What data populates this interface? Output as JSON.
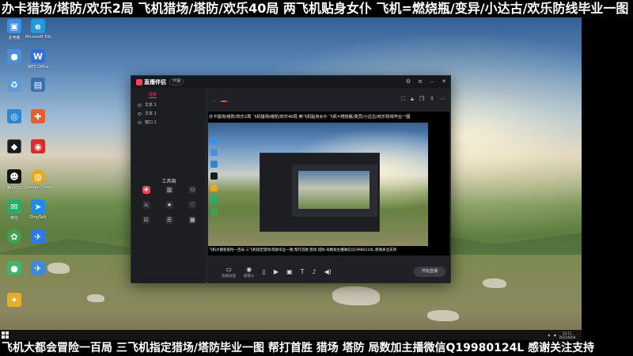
{
  "banners": {
    "top": "办卡猎场/塔防/欢乐2局 飞机猎场/塔防/欢乐40局 两飞机贴身女仆 飞机=燃烧瓶/变异/小达古/欢乐防线毕业一图",
    "bottom": "飞机大都会冒险一百局 三飞机指定猎场/塔防毕业一图 帮打首胜 猎场 塔防 局数加主播微信Q19980124L 感谢关注支持"
  },
  "desktop_icons": [
    {
      "label": "此电脑",
      "icon": "computer-icon",
      "color": "#3b8fe8"
    },
    {
      "label": "Microsoft Edge",
      "icon": "edge-icon",
      "color": "#1e9be0"
    },
    {
      "label": "",
      "icon": "person-icon",
      "color": "#4a90d9"
    },
    {
      "label": "WPS Office",
      "icon": "wps-icon",
      "color": "#2f6fd8"
    },
    {
      "label": "",
      "icon": "recycle-icon",
      "color": "#5b9bd5"
    },
    {
      "label": "",
      "icon": "app-icon",
      "color": "#3a6fb0"
    },
    {
      "label": "",
      "icon": "network-icon",
      "color": "#2b86d6"
    },
    {
      "label": "",
      "icon": "tools-icon",
      "color": "#e85d2c"
    },
    {
      "label": "",
      "icon": "game-icon",
      "color": "#1b1b1b"
    },
    {
      "label": "",
      "icon": "netease-icon",
      "color": "#d92c2c"
    },
    {
      "label": "腾讯QQ",
      "icon": "qq-icon",
      "color": "#141414"
    },
    {
      "label": "Google Chrome",
      "icon": "chrome-icon",
      "color": "#e9a91c"
    },
    {
      "label": "微信",
      "icon": "wechat-icon",
      "color": "#2aae67"
    },
    {
      "label": "DingTalk",
      "icon": "dingtalk-icon",
      "color": "#1a8cf0"
    },
    {
      "label": "",
      "icon": "app2-icon",
      "color": "#3fa34d"
    },
    {
      "label": "",
      "icon": "bird-icon",
      "color": "#2b7ae8"
    },
    {
      "label": "",
      "icon": "game2-icon",
      "color": "#3fb56a"
    },
    {
      "label": "",
      "icon": "plane-icon",
      "color": "#3c8ad8"
    },
    {
      "label": "",
      "icon": "puzzle-icon",
      "color": "#e6ad2b"
    }
  ],
  "app": {
    "name": "直播伴侣",
    "title_badge": "开播",
    "announcement": "",
    "left_tabs": [
      "",
      "",
      "场景"
    ],
    "scenes": [
      "文本 1",
      "文本 1",
      "窗口 1"
    ],
    "toolbox_title": "工具箱",
    "tools": [
      {
        "label": "",
        "icon": "gift-icon",
        "hot": true
      },
      {
        "label": "",
        "icon": "chart-icon",
        "hot": false
      },
      {
        "label": "",
        "icon": "link-icon",
        "hot": false
      },
      {
        "label": "",
        "icon": "pk-icon",
        "hot": false
      },
      {
        "label": "",
        "icon": "star-icon",
        "hot": false
      },
      {
        "label": "",
        "icon": "wish-icon",
        "hot": false
      },
      {
        "label": "",
        "icon": "vote-icon",
        "hot": false
      },
      {
        "label": "",
        "icon": "task-icon",
        "hot": false
      },
      {
        "label": "",
        "icon": "calendar-icon",
        "hot": false
      }
    ],
    "footer_tip": "",
    "stream_title": "",
    "stream_meta": {
      "chip1": "",
      "chip2": "",
      "text": ""
    },
    "preview": {
      "top_text": "办卡猎场/塔防/欢乐2局 飞机猎场/塔防/欢乐40局 两飞机贴身女仆 飞机=燃烧瓶/变异/小达古/欢乐防线毕业一图",
      "bottom_text": "飞机大都会冒险一百局 三飞机指定猎场/塔防毕业一图 帮打首胜 猎场 塔防 局数加主播微信Q19980124L 感谢关注支持"
    },
    "bottom_tools": [
      {
        "label": "直播画面",
        "icon": "screen-icon"
      },
      {
        "label": "摄像头",
        "icon": "camera-icon"
      },
      {
        "label": "",
        "icon": "phone-icon"
      },
      {
        "label": "",
        "icon": "play-icon"
      },
      {
        "label": "",
        "icon": "image-icon"
      },
      {
        "label": "",
        "icon": "text-icon"
      },
      {
        "label": "",
        "icon": "mic-icon"
      },
      {
        "label": "",
        "icon": "volume-icon"
      }
    ],
    "cpu_warning": "",
    "start_live": "开始直播"
  },
  "taskbar": {
    "tray_text": "",
    "time": "23:11",
    "date": "2021/9/28"
  }
}
